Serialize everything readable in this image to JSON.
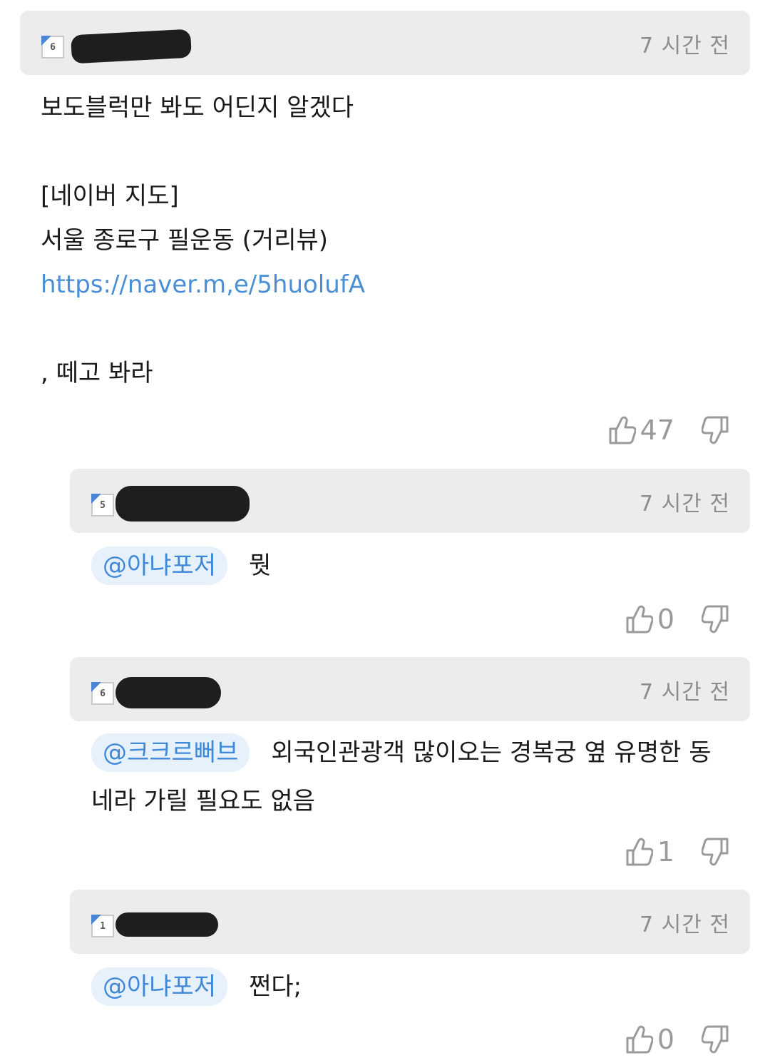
{
  "comments": [
    {
      "level": "6",
      "time": "7 시간 전",
      "lines": [
        "보도블럭만 봐도 어딘지 알겠다",
        "",
        "[네이버 지도]",
        "서울 종로구 필운동 (거리뷰)"
      ],
      "link": "https://naver.m,e/5huolufA",
      "tail": ", 떼고 봐라",
      "likes": "47"
    },
    {
      "level": "5",
      "time": "7 시간 전",
      "mention": "@아냐포저",
      "text": "뭣",
      "likes": "0"
    },
    {
      "level": "6",
      "time": "7 시간 전",
      "mention": "@크크르뻐브",
      "text": "외국인관광객 많이오는 경복궁 옆 유명한 동",
      "text2": "네라 가릴 필요도 없음",
      "likes": "1"
    },
    {
      "level": "1",
      "time": "7 시간 전",
      "mention": "@아냐포저",
      "text": "쩐다;",
      "likes": "0"
    }
  ],
  "colors": {
    "header_bg": "#ececec",
    "link": "#4a8fd6",
    "mention_bg": "#e7f1fc",
    "mention_text": "#3f89d8",
    "muted": "#8d8d8d"
  },
  "icons": [
    "thumbs-up-icon",
    "thumbs-down-icon"
  ]
}
